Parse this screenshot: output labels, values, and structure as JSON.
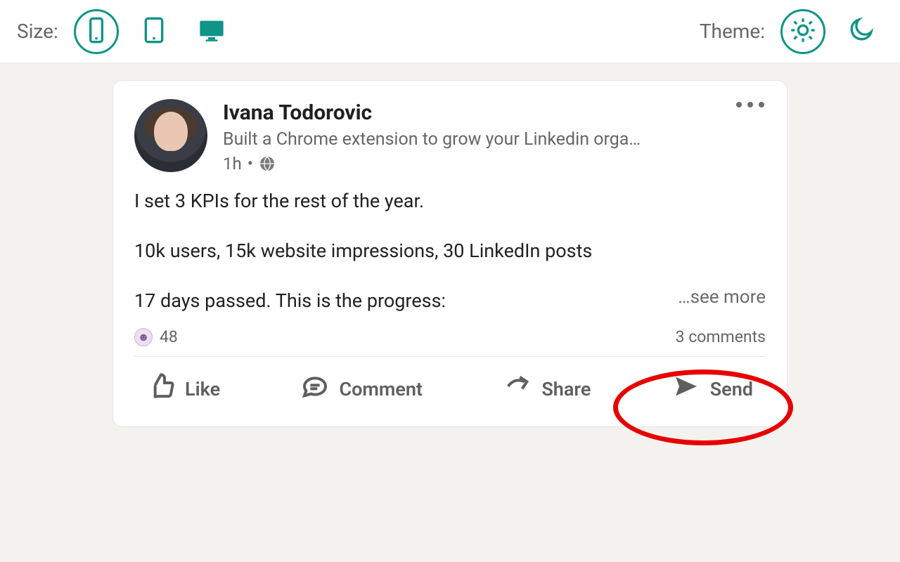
{
  "toolbar": {
    "size_label": "Size:",
    "theme_label": "Theme:"
  },
  "post": {
    "author_name": "Ivana Todorovic",
    "headline": "Built a Chrome extension to grow your Linkedin orga…",
    "time": "1h",
    "sep": "•",
    "body_line1": "I set 3 KPIs for the rest of the year.",
    "body_line2": "10k users, 15k website impressions, 30 LinkedIn posts",
    "body_line3": "17 days passed. This is the progress:",
    "see_more": "…see more",
    "reaction_count": "48",
    "comments_text": "3 comments"
  },
  "actions": {
    "like": "Like",
    "comment": "Comment",
    "share": "Share",
    "send": "Send"
  }
}
